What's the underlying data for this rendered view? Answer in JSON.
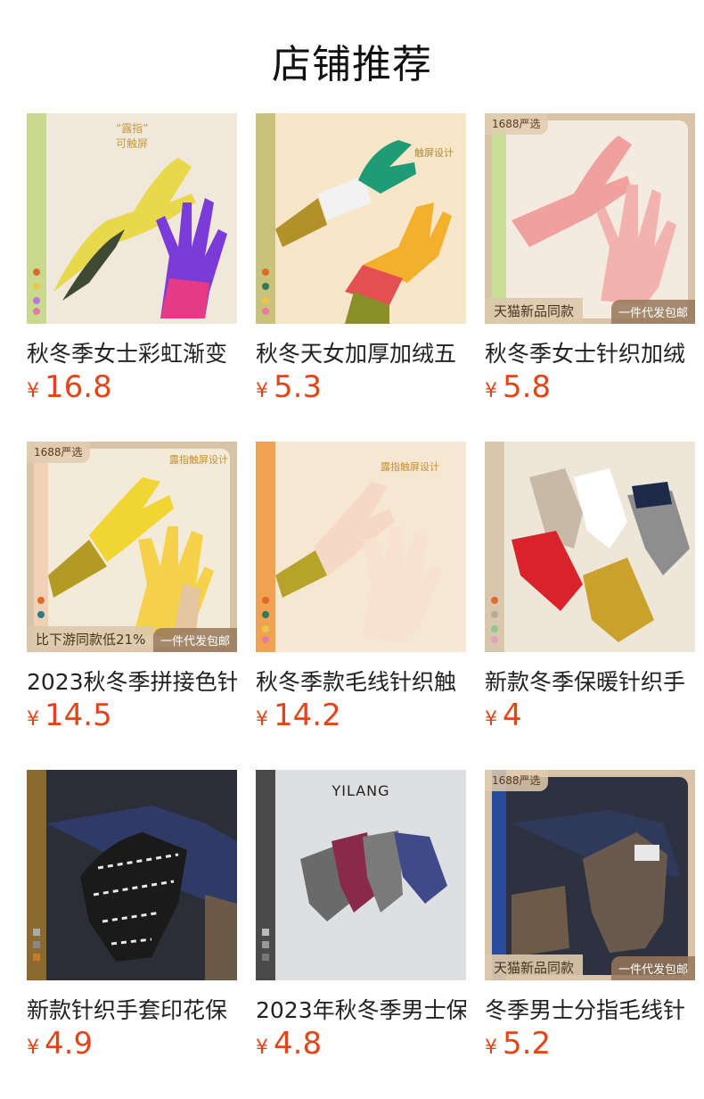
{
  "section": {
    "title": "店铺推荐"
  },
  "products": [
    {
      "name": "秋冬季女士彩虹渐变",
      "currency": "¥",
      "price": "16.8",
      "overlay_text": "“露指”\n可触屏",
      "badges": {}
    },
    {
      "name": "秋冬天女加厚加绒五",
      "currency": "¥",
      "price": "5.3",
      "overlay_text": "触屏设计",
      "badges": {}
    },
    {
      "name": "秋冬季女士针织加绒",
      "currency": "¥",
      "price": "5.8",
      "overlay_text": "",
      "badges": {
        "top_left": "1688严选",
        "bottom_left": "天猫新品同款",
        "bottom_right": "一件代发包邮"
      }
    },
    {
      "name": "2023秋冬季拼接色针",
      "currency": "¥",
      "price": "14.5",
      "overlay_text": "露指触屏设计",
      "badges": {
        "top_left": "1688严选",
        "bottom_left": "比下游同款低21%",
        "bottom_right": "一件代发包邮"
      }
    },
    {
      "name": "秋冬季款毛线针织触",
      "currency": "¥",
      "price": "14.2",
      "overlay_text": "露指触屏设计",
      "badges": {}
    },
    {
      "name": "新款冬季保暖针织手",
      "currency": "¥",
      "price": "4",
      "overlay_text": "",
      "badges": {}
    },
    {
      "name": "新款针织手套印花保",
      "currency": "¥",
      "price": "4.9",
      "overlay_text": "",
      "badges": {}
    },
    {
      "name": "2023年秋冬季男士保",
      "currency": "¥",
      "price": "4.8",
      "overlay_text": "YILANG",
      "badges": {}
    },
    {
      "name": "冬季男士分指毛线针",
      "currency": "¥",
      "price": "5.2",
      "overlay_text": "",
      "badges": {
        "top_left": "1688严选",
        "bottom_left": "天猫新品同款",
        "bottom_right": "一件代发包邮"
      }
    }
  ],
  "colors": {
    "price": "#e0461a",
    "title": "#111111"
  },
  "icons": [
    "glove-product-image"
  ]
}
